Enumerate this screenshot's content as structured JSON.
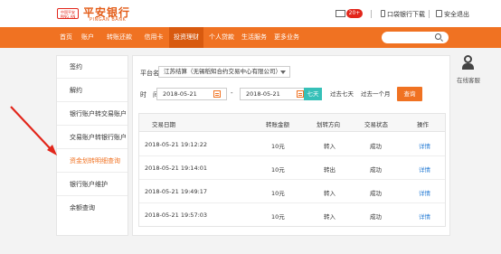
{
  "header": {
    "logo_badge": "中国平安",
    "logo_badge_sub": "PING AN",
    "logo_title": "平安银行",
    "logo_subtitle": "PINGAN BANK",
    "mail_count": "20+",
    "download_label": "口袋银行下载",
    "logout_label": "安全退出"
  },
  "nav": {
    "items": [
      "首页",
      "账户",
      "转账还款",
      "信用卡",
      "投资理财",
      "个人贷款",
      "生活服务",
      "更多业务"
    ],
    "active_index": 4,
    "search_placeholder": ""
  },
  "sidebar": {
    "items": [
      "签约",
      "解约",
      "银行账户转交易账户",
      "交易账户转银行账户",
      "资金划转明细查询",
      "银行账户维护",
      "余额查询"
    ],
    "active_index": 4
  },
  "filters": {
    "platform_label": "平台名称：",
    "platform_value": "江苏结算（无锡稻知合约交易中心有限公司）",
    "time_label": "时　间：",
    "date_from": "2018-05-21",
    "date_to": "2018-05-21",
    "dash": "-",
    "quick_today": "七天",
    "quick_seven": "过去七天",
    "quick_month": "过去一个月",
    "query_button": "查询"
  },
  "table": {
    "columns": [
      "交易日期",
      "转账金额",
      "划转方向",
      "交易状态",
      "操作"
    ],
    "rows": [
      [
        "2018-05-21  19:12:22",
        "10元",
        "转入",
        "成功",
        "详情"
      ],
      [
        "2018-05-21  19:14:01",
        "10元",
        "转出",
        "成功",
        "详情"
      ],
      [
        "2018-05-21  19:49:17",
        "10元",
        "转入",
        "成功",
        "详情"
      ],
      [
        "2018-05-21  19:57:03",
        "10元",
        "转入",
        "成功",
        "详情"
      ]
    ]
  },
  "service": {
    "label": "在线客服"
  },
  "colors": {
    "brand_orange": "#f07222",
    "nav_active": "#d85a0f",
    "link_blue": "#2b7fd6",
    "today_teal": "#36c0b8",
    "annotation_red": "#e2261b"
  }
}
